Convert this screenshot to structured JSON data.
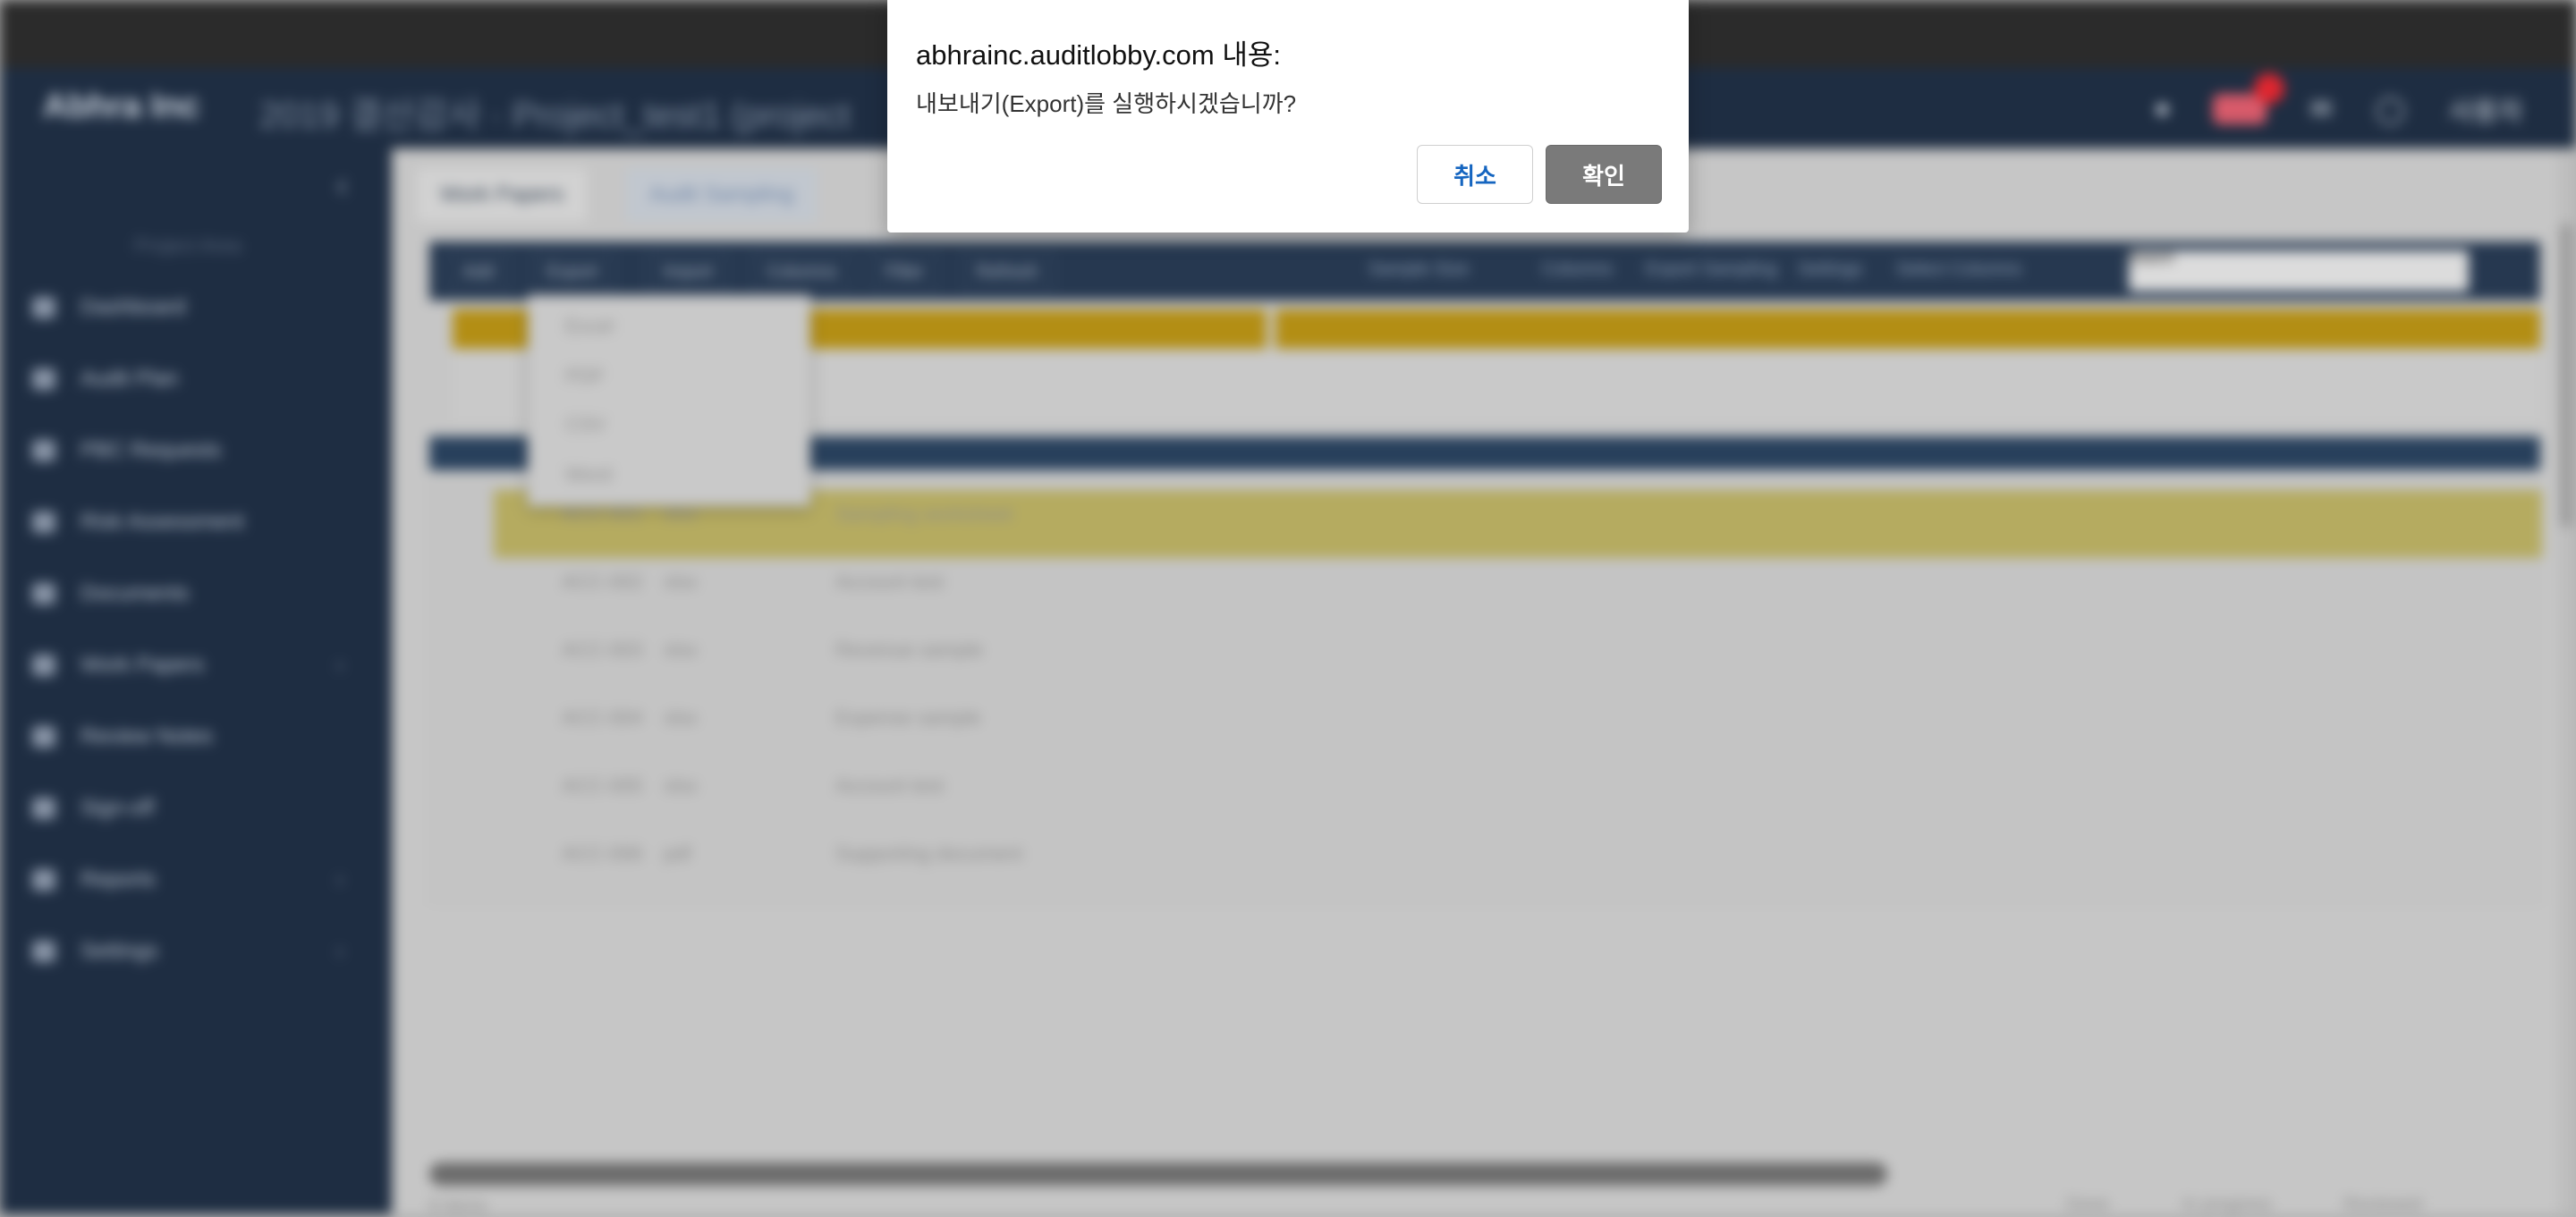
{
  "dialog": {
    "title": "abhrainc.auditlobby.com 내용:",
    "message": "내보내기(Export)를 실행하시겠습니까?",
    "cancel_label": "취소",
    "ok_label": "확인"
  },
  "background": {
    "brand": "Abhra Inc",
    "page_title": "2019 결산감사 · Project_test1 (project",
    "user_label": "사용자",
    "sidebar_section": "Project Area",
    "sidebar_items": [
      {
        "label": "Dashboard",
        "chevron": ""
      },
      {
        "label": "Audit Plan",
        "chevron": ""
      },
      {
        "label": "PBC Requests",
        "chevron": ""
      },
      {
        "label": "Risk Assessment",
        "chevron": ""
      },
      {
        "label": "Documents",
        "chevron": ""
      },
      {
        "label": "Work Papers",
        "chevron": "›"
      },
      {
        "label": "Review Notes",
        "chevron": ""
      },
      {
        "label": "Sign-off",
        "chevron": ""
      },
      {
        "label": "Reports",
        "chevron": "›"
      },
      {
        "label": "Settings",
        "chevron": "›"
      }
    ],
    "tabs": [
      "Work Papers",
      "Audit Sampling"
    ],
    "toolbar_buttons": [
      "Add",
      "Export",
      "Import",
      "Columns",
      "Filter",
      "Refresh"
    ],
    "toolbar_links": [
      "Sample Size",
      "Columns",
      "Export Sampling",
      "Settings",
      "Select Columns"
    ],
    "search_placeholder": "Search",
    "dropdown_items": [
      "Excel",
      "PDF",
      "CSV",
      "Word"
    ],
    "rows": [
      {
        "c1": "ACC-001",
        "c2": "xlsx",
        "c3": "Sampling worksheet"
      },
      {
        "c1": "ACC-002",
        "c2": "xlsx",
        "c3": "Account test"
      },
      {
        "c1": "ACC-003",
        "c2": "xlsx",
        "c3": "Revenue sample"
      },
      {
        "c1": "ACC-004",
        "c2": "xlsx",
        "c3": "Expense sample"
      },
      {
        "c1": "ACC-005",
        "c2": "xlsx",
        "c3": "Account test"
      },
      {
        "c1": "ACC-006",
        "c2": "pdf",
        "c3": "Supporting document"
      }
    ],
    "footer_count": "6 items",
    "legend": [
      "Done",
      "In progress",
      "Reviewed"
    ]
  },
  "colors": {
    "topbar": "#1e2d42",
    "header_gold": "#b38e14",
    "highlight_row": "#b5ab60",
    "cancel_text": "#1565c0",
    "ok_button": "#7a7a7a"
  }
}
